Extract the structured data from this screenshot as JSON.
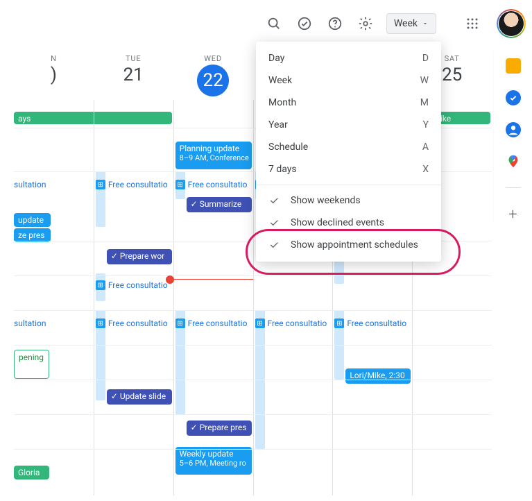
{
  "topbar": {
    "view_label": "Week"
  },
  "dropdown": {
    "items": [
      {
        "label": "Day",
        "key": "D"
      },
      {
        "label": "Week",
        "key": "W"
      },
      {
        "label": "Month",
        "key": "M"
      },
      {
        "label": "Year",
        "key": "Y"
      },
      {
        "label": "Schedule",
        "key": "A"
      },
      {
        "label": "7 days",
        "key": "X"
      }
    ],
    "toggles": {
      "show_weekends": "Show weekends",
      "show_declined": "Show declined events",
      "show_appointment": "Show appointment schedules"
    }
  },
  "days": [
    {
      "name": "N",
      "num": ")"
    },
    {
      "name": "TUE",
      "num": "21"
    },
    {
      "name": "WED",
      "num": "22"
    },
    {
      "name": "",
      "num": ""
    },
    {
      "name": "",
      "num": ""
    },
    {
      "name": "SAT",
      "num": "25"
    }
  ],
  "events": {
    "ays": "ays",
    "new_bike": "new bike",
    "planning_update_title": "Planning update",
    "planning_update_sub": "8–9 AM, Conference",
    "summarize": "Summarize",
    "update": "update",
    "ze_pres": "ze pres",
    "prepare_work": "Prepare wor",
    "pening": "pening",
    "update_slide": "Update slide",
    "prepare_pres": "Prepare pres",
    "lori_mike": "Lori/Mike",
    "lori_mike_time": "2:30",
    "weekly_update_title": "Weekly update",
    "weekly_update_sub": "5–6 PM, Meeting ro",
    "gloria": "Gloria",
    "free_consultation": "Free consultatio",
    "free_short": "Fr",
    "sultation": "sultation"
  }
}
